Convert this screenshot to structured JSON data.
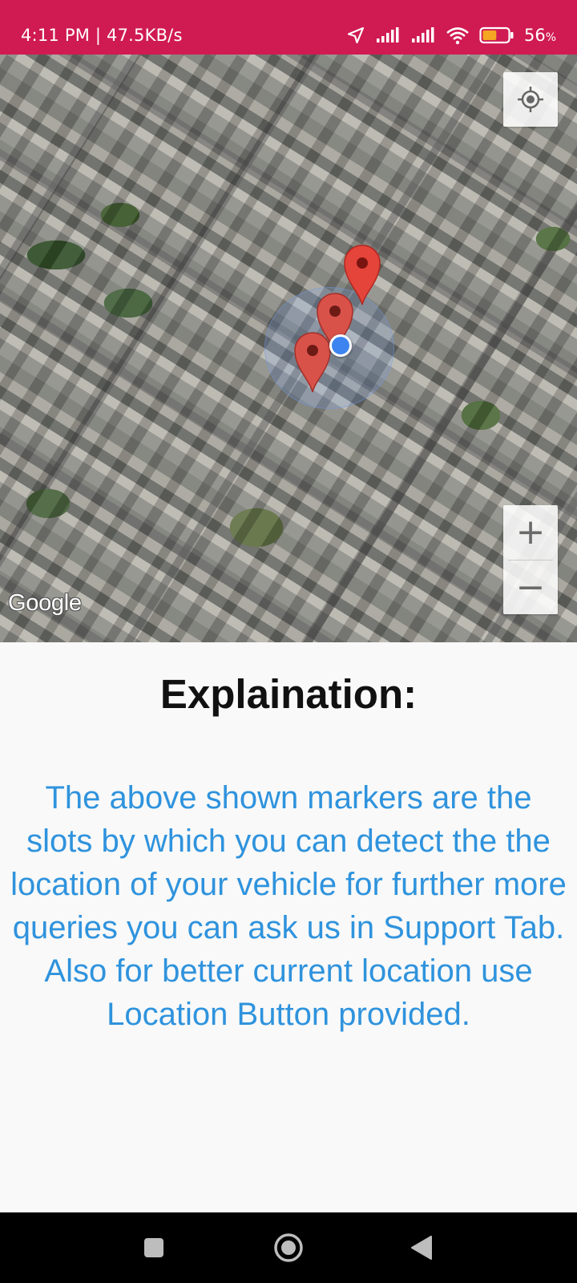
{
  "status_bar": {
    "time_speed": "4:11 PM | 47.5KB/s",
    "battery_percent": "56",
    "battery_unit": "%",
    "icons": [
      "location-arrow-icon",
      "signal-icon",
      "signal-icon",
      "wifi-icon",
      "battery-icon"
    ],
    "battery_level": 0.56
  },
  "map": {
    "attribution": "Google",
    "controls": {
      "my_location": "crosshair-icon",
      "zoom_in": "+",
      "zoom_out": "−"
    },
    "marker_count": 3,
    "marker_color": "#e5443b"
  },
  "explanation": {
    "title": "Explaination:",
    "body": "The above shown markers are the slots by which you can detect the the location of your vehicle for further more queries you can ask us in Support Tab. Also for better current location use Location Button provided."
  },
  "colors": {
    "status_bar": "#d01a52",
    "body_text": "#2f93dd",
    "title_text": "#111111",
    "nav_bar": "#000000"
  },
  "nav_bar": {
    "icons": [
      "square-recents-icon",
      "circle-home-icon",
      "triangle-back-icon"
    ]
  }
}
